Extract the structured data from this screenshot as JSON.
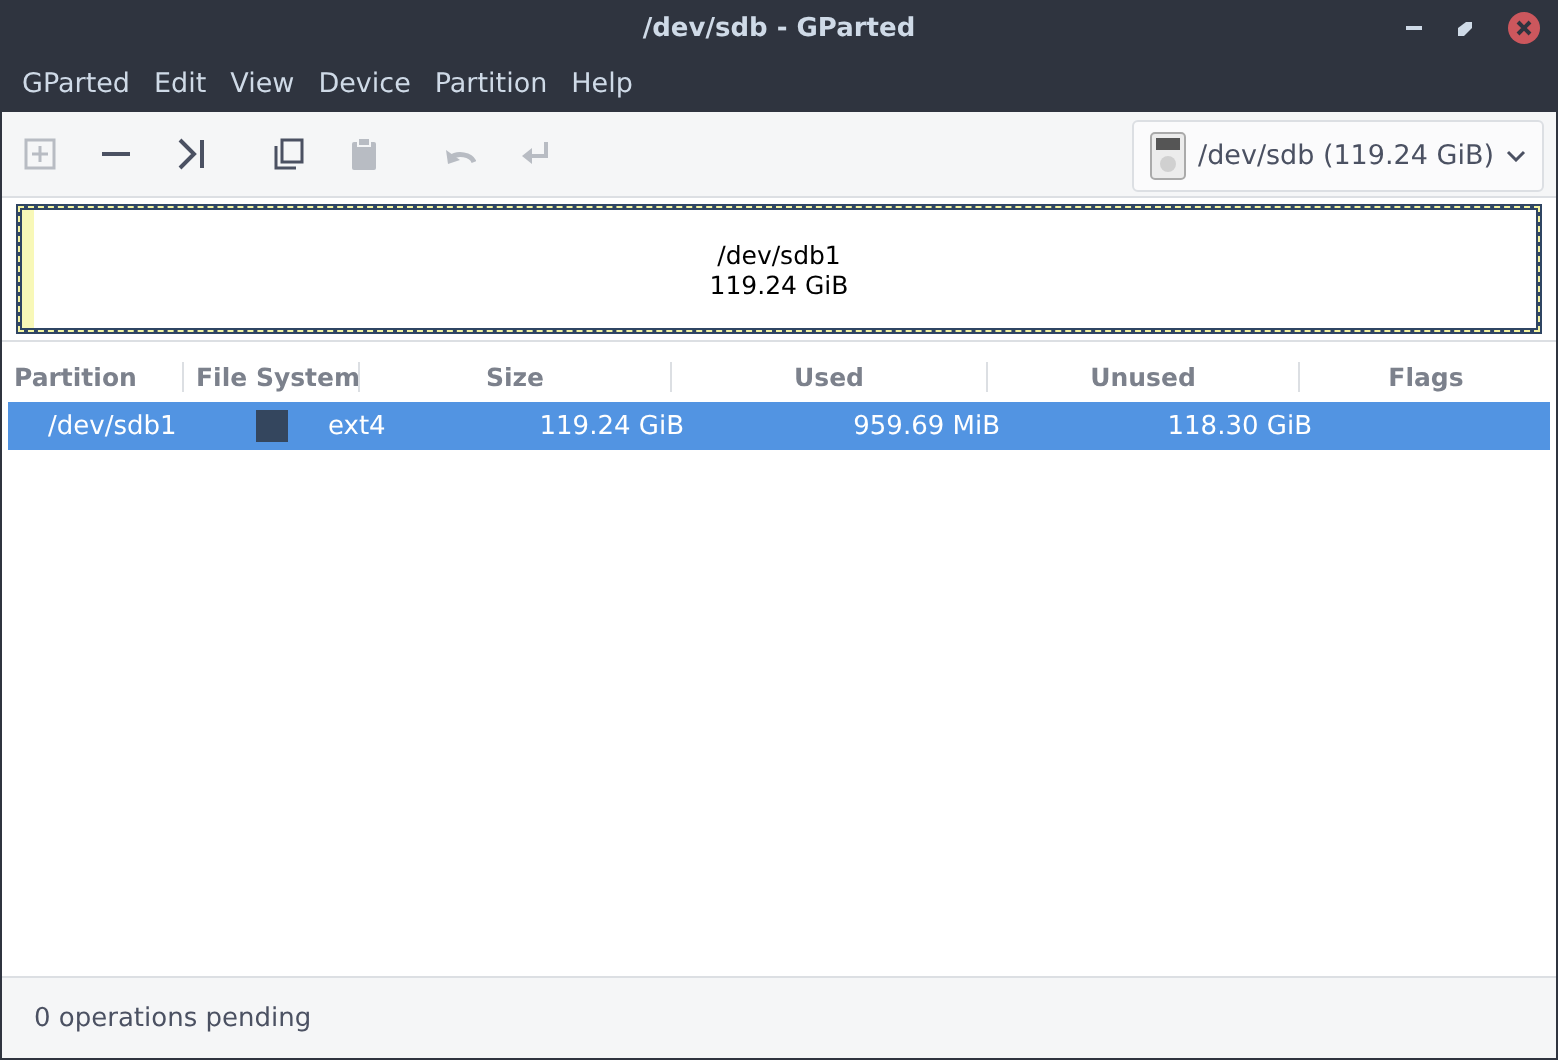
{
  "window": {
    "title": "/dev/sdb - GParted"
  },
  "menu": [
    "GParted",
    "Edit",
    "View",
    "Device",
    "Partition",
    "Help"
  ],
  "toolbar": [
    {
      "kind": "new",
      "disabled": true
    },
    {
      "kind": "delete",
      "disabled": false
    },
    {
      "kind": "resize",
      "disabled": false
    },
    {
      "kind": "copy",
      "disabled": false
    },
    {
      "kind": "paste",
      "disabled": true
    },
    {
      "kind": "undo",
      "disabled": true
    },
    {
      "kind": "apply",
      "disabled": true
    }
  ],
  "device": {
    "label": "/dev/sdb (119.24 GiB)"
  },
  "partition_map": [
    {
      "name": "/dev/sdb1",
      "size": "119.24 GiB",
      "level": 0.008,
      "selected": true
    }
  ],
  "table": {
    "columns": [
      "Partition",
      "File System",
      "Size",
      "Used",
      "Unused",
      "Flags"
    ],
    "rows": [
      {
        "partition": "/dev/sdb1",
        "color": "#34465e",
        "file_system": "ext4",
        "size": "119.24 GiB",
        "used": "959.69 MiB",
        "unused": "118.30 GiB",
        "selected": true
      }
    ]
  },
  "status_bar": "0 operations pending"
}
